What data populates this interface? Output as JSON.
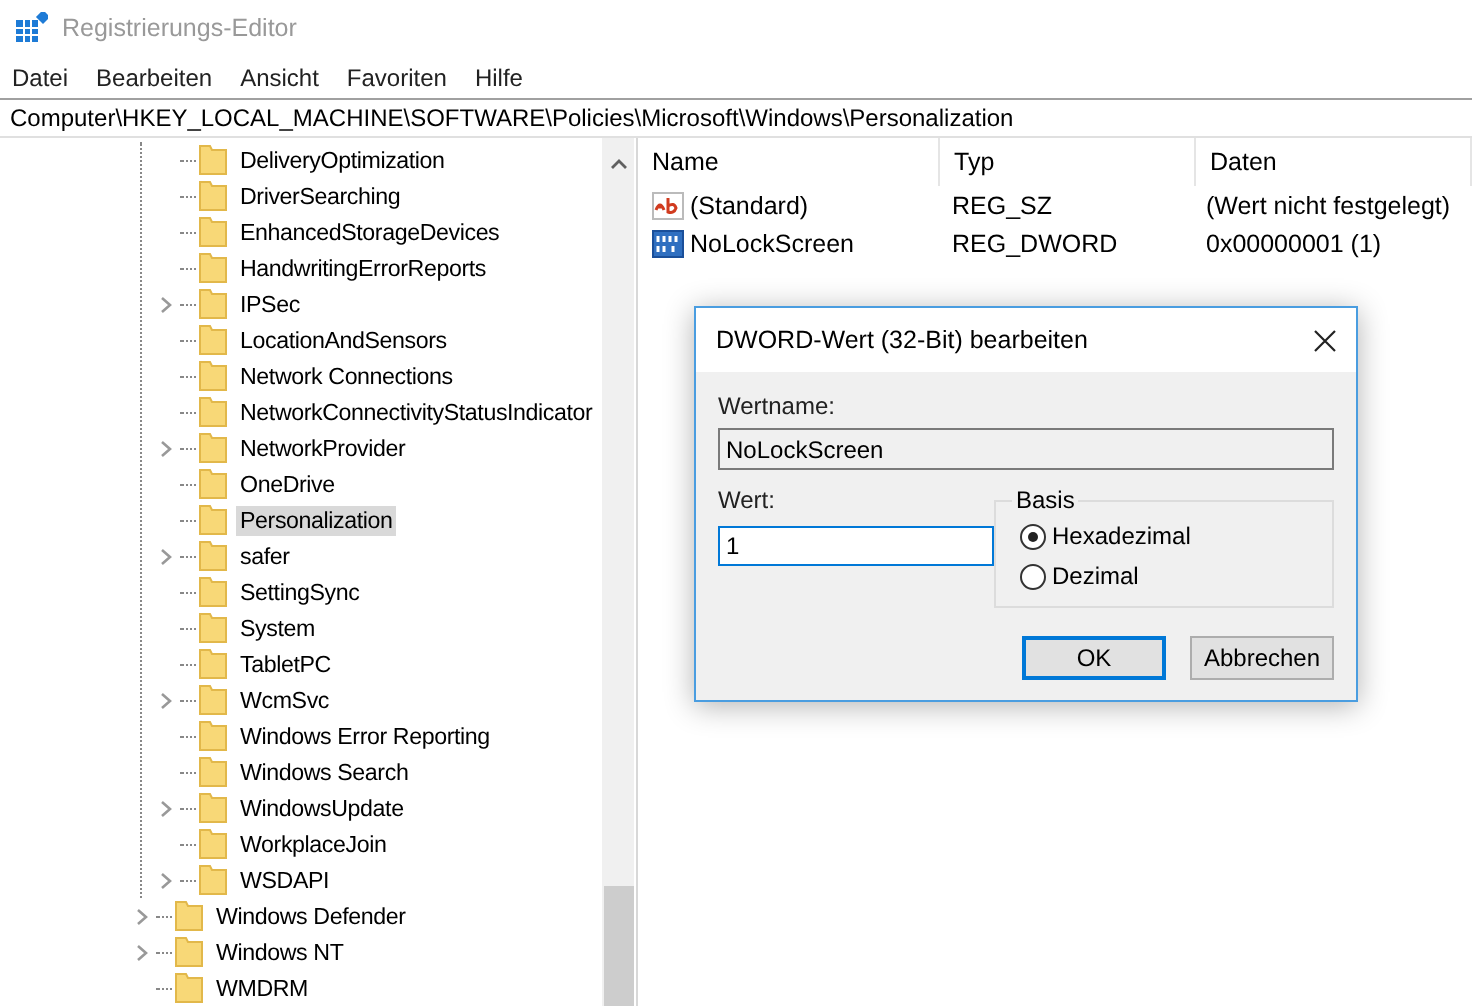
{
  "window": {
    "title": "Registrierungs-Editor"
  },
  "menu": [
    "Datei",
    "Bearbeiten",
    "Ansicht",
    "Favoriten",
    "Hilfe"
  ],
  "address": "Computer\\HKEY_LOCAL_MACHINE\\SOFTWARE\\Policies\\Microsoft\\Windows\\Personalization",
  "tree": [
    {
      "children": [
        {
          "label": "DeliveryOptimization",
          "expandable": false,
          "selected": false
        },
        {
          "label": "DriverSearching",
          "expandable": false,
          "selected": false
        },
        {
          "label": "EnhancedStorageDevices",
          "expandable": false,
          "selected": false
        },
        {
          "label": "HandwritingErrorReports",
          "expandable": false,
          "selected": false
        },
        {
          "label": "IPSec",
          "expandable": true,
          "selected": false
        },
        {
          "label": "LocationAndSensors",
          "expandable": false,
          "selected": false
        },
        {
          "label": "Network Connections",
          "expandable": false,
          "selected": false
        },
        {
          "label": "NetworkConnectivityStatusIndicator",
          "expandable": false,
          "selected": false
        },
        {
          "label": "NetworkProvider",
          "expandable": true,
          "selected": false
        },
        {
          "label": "OneDrive",
          "expandable": false,
          "selected": false
        },
        {
          "label": "Personalization",
          "expandable": false,
          "selected": true
        },
        {
          "label": "safer",
          "expandable": true,
          "selected": false
        },
        {
          "label": "SettingSync",
          "expandable": false,
          "selected": false
        },
        {
          "label": "System",
          "expandable": false,
          "selected": false
        },
        {
          "label": "TabletPC",
          "expandable": false,
          "selected": false
        },
        {
          "label": "WcmSvc",
          "expandable": true,
          "selected": false
        },
        {
          "label": "Windows Error Reporting",
          "expandable": false,
          "selected": false
        },
        {
          "label": "Windows Search",
          "expandable": false,
          "selected": false
        },
        {
          "label": "WindowsUpdate",
          "expandable": true,
          "selected": false
        },
        {
          "label": "WorkplaceJoin",
          "expandable": false,
          "selected": false
        },
        {
          "label": "WSDAPI",
          "expandable": true,
          "selected": false
        }
      ]
    },
    {
      "label": "Windows Defender",
      "expandable": true,
      "selected": false
    },
    {
      "label": "Windows NT",
      "expandable": true,
      "selected": false
    },
    {
      "label": "WMDRM",
      "expandable": false,
      "selected": false
    }
  ],
  "values": {
    "columns": [
      "Name",
      "Typ",
      "Daten"
    ],
    "rows": [
      {
        "kind": "string",
        "name": "(Standard)",
        "type": "REG_SZ",
        "data": "(Wert nicht festgelegt)"
      },
      {
        "kind": "binary",
        "name": "NoLockScreen",
        "type": "REG_DWORD",
        "data": "0x00000001 (1)"
      }
    ]
  },
  "dialog": {
    "title": "DWORD-Wert (32-Bit) bearbeiten",
    "name_label": "Wertname:",
    "name_value": "NoLockScreen",
    "value_label": "Wert:",
    "value": "1",
    "base_label": "Basis",
    "bases": [
      {
        "label": "Hexadezimal",
        "selected": true
      },
      {
        "label": "Dezimal",
        "selected": false
      }
    ],
    "buttons": [
      {
        "label": "OK",
        "default": true
      },
      {
        "label": "Abbrechen",
        "default": false
      }
    ]
  }
}
